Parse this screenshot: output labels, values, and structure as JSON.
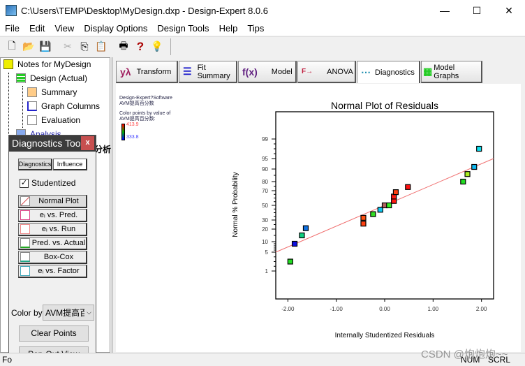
{
  "window": {
    "title": "C:\\Users\\TEMP\\Desktop\\MyDesign.dxp - Design-Expert 8.0.6",
    "minimize": "—",
    "maximize": "☐",
    "close": "✕"
  },
  "menu": [
    "File",
    "Edit",
    "View",
    "Display Options",
    "Design Tools",
    "Help",
    "Tips"
  ],
  "toolbar": [
    {
      "icon": "new-icon",
      "glyph": "🗋"
    },
    {
      "icon": "open-icon",
      "glyph": "📂"
    },
    {
      "icon": "save-icon",
      "glyph": "💾"
    },
    {
      "icon": "cut-icon",
      "glyph": "✂"
    },
    {
      "icon": "copy-icon",
      "glyph": "⎘"
    },
    {
      "icon": "paste-icon",
      "glyph": "📋"
    },
    {
      "icon": "print-icon",
      "glyph": "🖶"
    },
    {
      "icon": "help-icon",
      "glyph": "?"
    },
    {
      "icon": "tips-icon",
      "glyph": "💡"
    }
  ],
  "tree": {
    "root": "Notes for MyDesign",
    "design": "Design (Actual)",
    "summary": "Summary",
    "graph_columns": "Graph Columns",
    "evaluation": "Evaluation",
    "analysis": "Analysis",
    "hidden_node": "分析"
  },
  "tabs": [
    {
      "label": "Transform",
      "icon": "yλ"
    },
    {
      "label": "Fit Summary",
      "icon": "☰"
    },
    {
      "label": "Model",
      "icon": "f(x)"
    },
    {
      "label": "ANOVA",
      "icon": "F→"
    },
    {
      "label": "Diagnostics",
      "icon": "⋯",
      "active": true
    },
    {
      "label": "Model Graphs",
      "icon": "▦"
    }
  ],
  "legend": {
    "software": "Design-Expert?Software",
    "response": "AVM提高百分数",
    "color_caption": "Color points by value of",
    "color_response": "AVM提高百分数:",
    "max": "413.9",
    "min": "333.8"
  },
  "diagnostics_tool": {
    "title": "Diagnostics Tool",
    "close": "x",
    "tab_diagnostics": "Diagnostics",
    "tab_influence": "Influence",
    "studentized_label": "Studentized",
    "studentized_checked": true,
    "plots": [
      "Normal Plot",
      "eᵢ vs. Pred.",
      "eᵢ vs. Run",
      "Pred. vs. Actual",
      "Box-Cox",
      "eᵢ vs. Factor"
    ],
    "color_by_label": "Color by",
    "color_by_value": "AVM提高百",
    "clear_points": "Clear Points",
    "pop_out": "Pop-Out View"
  },
  "status": {
    "left": "Fo",
    "num": "NUM",
    "scrl": "SCRL",
    "watermark": "CSDN @炮炮炮~~"
  },
  "chart_data": {
    "type": "scatter",
    "title": "Normal Plot of Residuals",
    "xlabel": "Internally Studentized Residuals",
    "ylabel": "Normal % Probability",
    "xlim": [
      -2.25,
      2.25
    ],
    "x_ticks": [
      "-2.00",
      "-1.00",
      "0.00",
      "1.00",
      "2.00"
    ],
    "y_scale": "normal probability",
    "y_ticks": [
      "1",
      "5",
      "10",
      "20",
      "30",
      "50",
      "70",
      "80",
      "90",
      "95",
      "99"
    ],
    "grid": false,
    "points": [
      {
        "x": -1.95,
        "y": 3,
        "color": "#22dd22"
      },
      {
        "x": -1.86,
        "y": 9,
        "color": "#1010e0"
      },
      {
        "x": -1.71,
        "y": 15,
        "color": "#10d080"
      },
      {
        "x": -1.63,
        "y": 21,
        "color": "#1070e0"
      },
      {
        "x": -0.44,
        "y": 26,
        "color": "#ff4010"
      },
      {
        "x": -0.44,
        "y": 33,
        "color": "#ff5010"
      },
      {
        "x": -0.24,
        "y": 38,
        "color": "#33dd22"
      },
      {
        "x": -0.09,
        "y": 44,
        "color": "#10c8f0"
      },
      {
        "x": 0.0,
        "y": 50,
        "color": "#b06060"
      },
      {
        "x": 0.09,
        "y": 50,
        "color": "#33ee22"
      },
      {
        "x": 0.19,
        "y": 56,
        "color": "#ff1a10"
      },
      {
        "x": 0.19,
        "y": 62,
        "color": "#ff1a10"
      },
      {
        "x": 0.23,
        "y": 68,
        "color": "#ff4010"
      },
      {
        "x": 0.48,
        "y": 74,
        "color": "#ff1010"
      },
      {
        "x": 1.62,
        "y": 80,
        "color": "#22dd22"
      },
      {
        "x": 1.71,
        "y": 86,
        "color": "#aaee22"
      },
      {
        "x": 1.85,
        "y": 91,
        "color": "#10b8f0"
      },
      {
        "x": 1.95,
        "y": 97,
        "color": "#10e0f0"
      }
    ],
    "normal_line": {
      "x": [
        -2.25,
        2.25
      ],
      "y": [
        5,
        95
      ],
      "color": "#f07070"
    }
  }
}
